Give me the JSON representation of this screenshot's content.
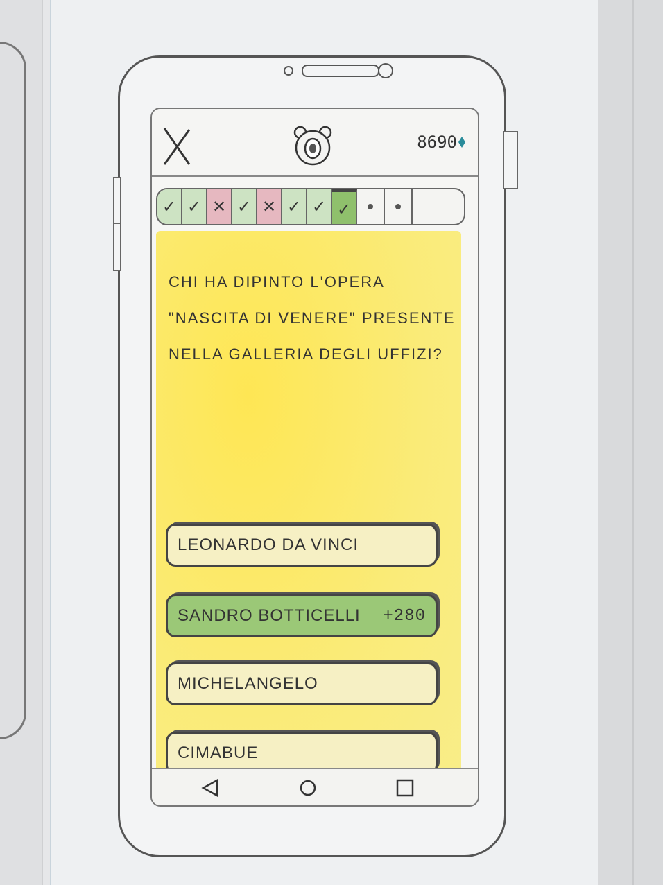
{
  "header": {
    "close_icon": "close-x-icon",
    "mascot_icon": "bear-mascot-icon",
    "score": "8690",
    "currency_icon": "diamond-icon",
    "currency_color": "#2a8c9a"
  },
  "progress": {
    "cells": [
      {
        "status": "correct",
        "symbol": "✓"
      },
      {
        "status": "correct",
        "symbol": "✓"
      },
      {
        "status": "wrong",
        "symbol": "✕"
      },
      {
        "status": "correct",
        "symbol": "✓"
      },
      {
        "status": "wrong",
        "symbol": "✕"
      },
      {
        "status": "correct",
        "symbol": "✓"
      },
      {
        "status": "correct",
        "symbol": "✓"
      },
      {
        "status": "current",
        "symbol": "✓"
      },
      {
        "status": "pending",
        "symbol": ""
      },
      {
        "status": "pending",
        "symbol": ""
      }
    ],
    "colors": {
      "correct": "#cde3c3",
      "wrong": "#e6b8c0",
      "current": "#8fc06c"
    }
  },
  "quiz": {
    "question": "CHI HA DIPINTO L'OPERA \"NASCITA DI VENERE\" PRESENTE NELLA GALLERIA DEGLI UFFIZI?",
    "answers": [
      {
        "label": "LEONARDO DA VINCI",
        "points": "",
        "correct": false
      },
      {
        "label": "SANDRO BOTTICELLI",
        "points": "+280",
        "correct": true
      },
      {
        "label": "MICHELANGELO",
        "points": "",
        "correct": false
      },
      {
        "label": "CIMABUE",
        "points": "",
        "correct": false
      }
    ],
    "background_color": "#f7ea7a",
    "correct_color": "#9bc877"
  },
  "navbar": {
    "back_icon": "triangle-back-icon",
    "home_icon": "circle-home-icon",
    "recents_icon": "square-recents-icon"
  }
}
